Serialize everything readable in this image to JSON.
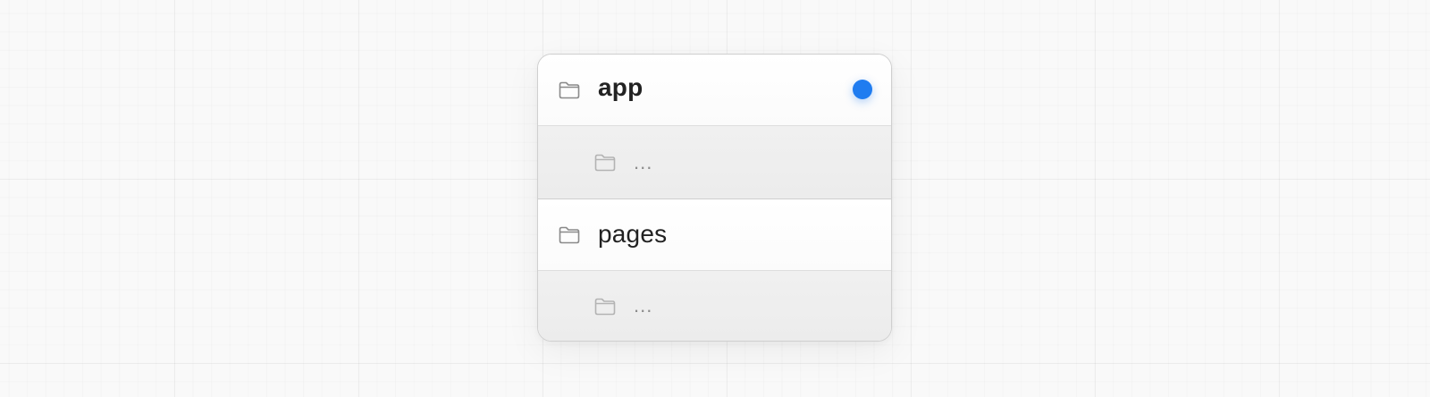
{
  "tree": {
    "items": [
      {
        "label": "app",
        "level": 0,
        "active": true,
        "icon": "folder-icon"
      },
      {
        "label": "...",
        "level": 1,
        "icon": "folder-icon"
      },
      {
        "label": "pages",
        "level": 0,
        "active": false,
        "icon": "folder-icon"
      },
      {
        "label": "...",
        "level": 1,
        "icon": "folder-icon"
      }
    ]
  },
  "colors": {
    "active_dot": "#1f7cf0",
    "folder_top": "#8a8a8a",
    "folder_sub": "#b3b3b3"
  }
}
